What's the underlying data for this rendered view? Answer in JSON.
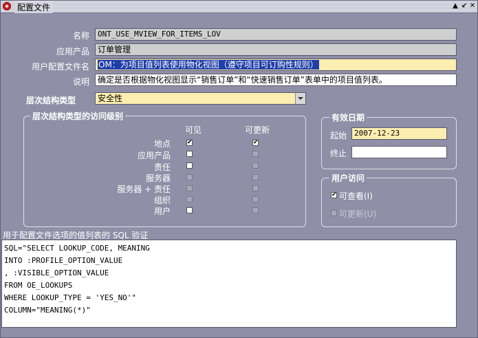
{
  "window": {
    "title": "配置文件",
    "minimize_glyph": "▲",
    "restore_glyph": "↙",
    "close_glyph": "✕"
  },
  "header": {
    "name_label": "名称",
    "name_value": "ONT_USE_MVIEW_FOR_ITEMS_LOV",
    "app_label": "应用产品",
    "app_value": "订单管理",
    "profile_label": "用户配置文件名",
    "profile_value": "OM：为项目值列表使用物化视图（遵守项目可订购性规则）",
    "desc_label": "说明",
    "desc_value": "确定是否根据物化视图显示“销售订单”和“快速销售订单”表单中的项目值列表。"
  },
  "hierarchy": {
    "label": "层次结构类型",
    "value": "安全性"
  },
  "access": {
    "title": "层次结构类型的访问级别",
    "col_visible": "可见",
    "col_updatable": "可更新",
    "rows": [
      {
        "label": "地点",
        "visible": true,
        "updatable": true,
        "visible_enabled": true,
        "updatable_enabled": true
      },
      {
        "label": "应用产品",
        "visible": false,
        "updatable": false,
        "visible_enabled": true,
        "updatable_enabled": false
      },
      {
        "label": "责任",
        "visible": false,
        "updatable": false,
        "visible_enabled": true,
        "updatable_enabled": false
      },
      {
        "label": "服务器",
        "visible": false,
        "updatable": false,
        "visible_enabled": false,
        "updatable_enabled": false
      },
      {
        "label": "服务器 + 责任",
        "visible": false,
        "updatable": false,
        "visible_enabled": false,
        "updatable_enabled": false
      },
      {
        "label": "组织",
        "visible": false,
        "updatable": false,
        "visible_enabled": false,
        "updatable_enabled": false
      },
      {
        "label": "用户",
        "visible": false,
        "updatable": false,
        "visible_enabled": true,
        "updatable_enabled": false
      }
    ]
  },
  "effective": {
    "title": "有效日期",
    "start_label": "起始",
    "start_value": "2007-12-23",
    "end_label": "终止",
    "end_value": ""
  },
  "user_access": {
    "title": "用户访问",
    "viewable_label": "可查看(I)",
    "updatable_label": "可更新(U)"
  },
  "sql": {
    "label": "用于配置文件选项的值列表的 SQL 验证",
    "lines": [
      "SQL=\"SELECT LOOKUP_CODE, MEANING",
      "INTO :PROFILE_OPTION_VALUE",
      ", :VISIBLE_OPTION_VALUE",
      "FROM OE_LOOKUPS",
      "WHERE LOOKUP_TYPE = 'YES_NO'\"",
      "COLUMN=\"MEANING(*)\""
    ]
  }
}
